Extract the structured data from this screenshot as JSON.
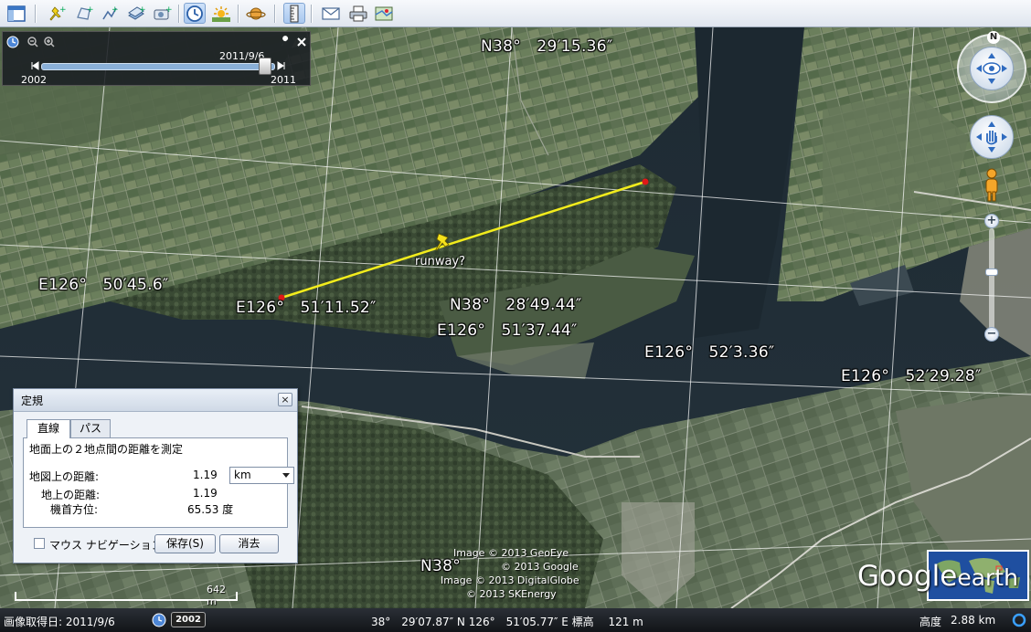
{
  "map": {
    "coords": [
      {
        "text": "N38°　29′15.36″"
      },
      {
        "text": "E126°　50′45.6″"
      },
      {
        "text": "E126°　51′11.52″"
      },
      {
        "text": "N38°　28′49.44″"
      },
      {
        "text": "E126°　51′37.44″"
      },
      {
        "text": "E126°　52′3.36″"
      },
      {
        "text": "E126°　52′29.28″"
      },
      {
        "text": "N38°"
      }
    ],
    "placemark_label": "runway?",
    "credits": [
      "Image © 2013 GeoEye",
      "© 2013 Google",
      "Image © 2013 DigitalGlobe",
      "© 2013 SKEnergy"
    ],
    "scale_label": "642 m",
    "logo_google": "Google",
    "logo_earth": "earth",
    "compass_north": "N",
    "ruler_line_color": "#f2ec1c"
  },
  "time_slider": {
    "current_date": "2011/9/6",
    "min_year": "2002",
    "max_year": "2011",
    "position": 0.96
  },
  "ruler_dialog": {
    "title": "定規",
    "close": "×",
    "tabs": [
      "直線",
      "パス"
    ],
    "description": "地面上の２地点間の距離を測定",
    "map_distance_label": "地図上の距離:",
    "map_distance_value": "1.19",
    "unit": "km",
    "ground_distance_label": "地上の距離:",
    "ground_distance_value": "1.19",
    "heading_label": "機首方位:",
    "heading_value": "65.53 度",
    "mouse_nav_label": "マウス ナビゲーション",
    "save_button": "保存(S)",
    "clear_button": "消去"
  },
  "status_bar": {
    "imagery_date": "画像取得日: 2011/9/6",
    "year_badge": "2002",
    "position": "38°　29′07.87″ N 126°　51′05.77″ E 標高　 121 m",
    "altitude_label": "高度",
    "altitude_value": "2.88 km"
  }
}
